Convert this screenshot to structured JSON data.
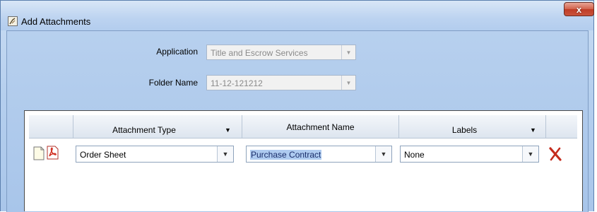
{
  "window": {
    "title": "Add Attachments",
    "close_label": "x"
  },
  "form": {
    "application": {
      "label": "Application",
      "value": "Title and Escrow Services"
    },
    "folder_name": {
      "label": "Folder Name",
      "value": "11-12-121212"
    }
  },
  "grid": {
    "columns": [
      {
        "label": "Attachment Type"
      },
      {
        "label": "Attachment Name"
      },
      {
        "label": "Labels"
      }
    ],
    "rows": [
      {
        "attachment_type": "Order Sheet",
        "attachment_name": "Purchase Contract",
        "labels": "None"
      }
    ]
  },
  "icons": {
    "title": "attachment-app-icon",
    "row_note": "blank-note-icon",
    "row_pdf": "pdf-icon",
    "row_delete": "delete-x-icon",
    "dropdown": "chevron-down-icon"
  },
  "colors": {
    "window_bg": "#b5cfee",
    "close_button": "#c9533c",
    "delete_icon": "#c42b1c",
    "selection": "#aecbf0"
  }
}
